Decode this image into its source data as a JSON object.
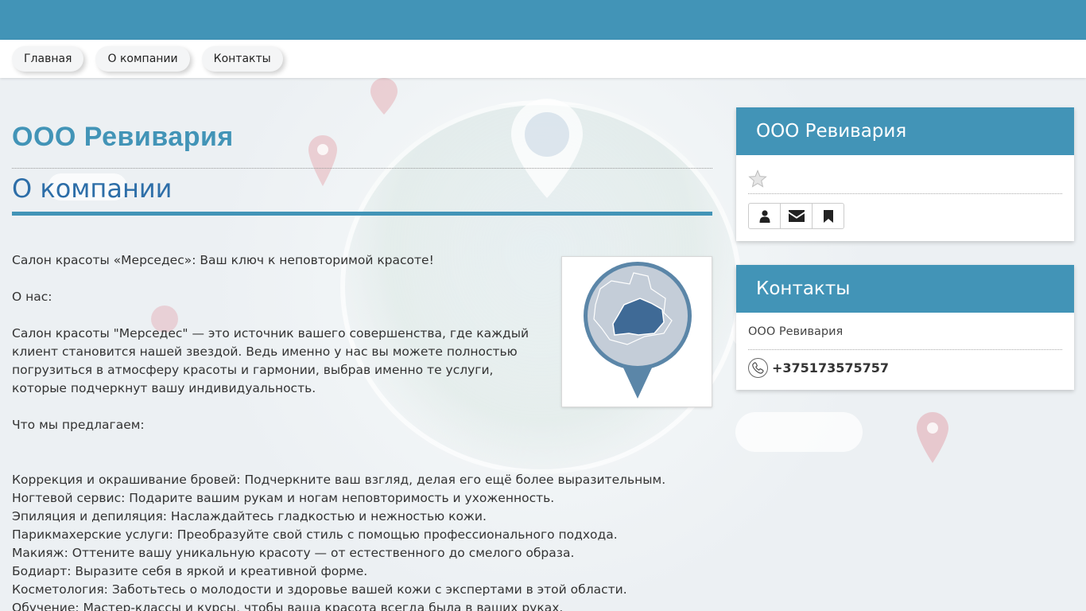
{
  "nav": {
    "items": [
      {
        "label": "Главная"
      },
      {
        "label": "О компании"
      },
      {
        "label": "Контакты"
      }
    ]
  },
  "main": {
    "company_title": "ООО Ревивария",
    "section_title": "О компании",
    "paragraphs": {
      "intro": "Салон красоты «Мерседес»: Ваш ключ к неповторимой красоте!",
      "about_heading": "О нас:",
      "about_line1": "Салон красоты \"Мерседес\" — это источник вашего совершенства, где каждый",
      "about_line2": "клиент становится нашей звездой. Ведь именно у нас вы можете полностью",
      "about_line3": "погрузиться в атмосферу красоты и гармонии, выбрав именно те услуги,",
      "about_line4": "которые подчеркнут вашу индивидуальность.",
      "offer_heading": "Что мы предлагаем:"
    },
    "services": [
      "Коррекция и окрашивание бровей: Подчеркните ваш взгляд, делая его ещё более выразительным.",
      "Ногтевой сервис: Подарите вашим рукам и ногам неповторимость и ухоженность.",
      "Эпиляция и депиляция: Наслаждайтесь гладкостью и нежностью кожи.",
      "Парикмахерские услуги: Преобразуйте свой стиль с помощью профессионального подхода.",
      "Макияж: Оттените вашу уникальную красоту — от естественного до смелого образа.",
      "Бодиарт: Выразите себя в яркой и креативной форме.",
      "Косметология: Заботьтесь о молодости и здоровье вашей кожи с экспертами в этой области.",
      "Обучение: Мастер-классы и курсы, чтобы ваша красота всегда была в ваших руках."
    ]
  },
  "sidebar": {
    "company_panel": {
      "title": "ООО Ревивария",
      "rating_icon": "star-icon",
      "buttons": [
        {
          "icon": "user-icon"
        },
        {
          "icon": "envelope-icon"
        },
        {
          "icon": "bookmark-icon"
        }
      ]
    },
    "contacts_panel": {
      "title": "Контакты",
      "company_name": "ООО Ревивария",
      "phone": "+375173575757",
      "phone_icon": "phone-icon"
    }
  },
  "colors": {
    "accent": "#4294b7",
    "section_title": "#2d6ea8",
    "map_dark": "#3f6a96",
    "map_light": "#c4cdd8"
  }
}
